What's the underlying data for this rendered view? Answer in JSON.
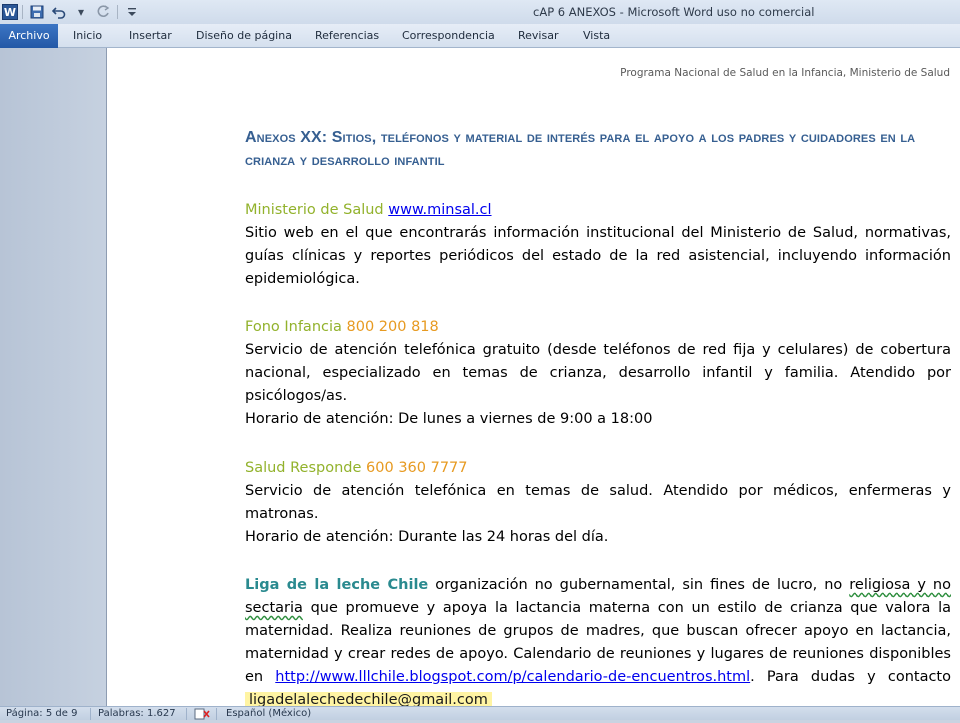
{
  "app": {
    "window_title": "cAP 6 ANEXOS - Microsoft Word uso no comercial",
    "word_logo": "W",
    "quick_access": [
      "save-icon",
      "undo-icon",
      "redo-icon",
      "customize-icon"
    ]
  },
  "ribbon": {
    "tabs": [
      "Archivo",
      "Inicio",
      "Insertar",
      "Diseño de página",
      "Referencias",
      "Correspondencia",
      "Revisar",
      "Vista"
    ]
  },
  "document": {
    "header_note": "Programa Nacional de Salud en la Infancia, Ministerio de Salud",
    "heading": "Anexos XX: Sitios, teléfonos y material de interés para el apoyo a los padres y cuidadores en la crianza y desarrollo infantil",
    "minsal": {
      "name": "Ministerio de Salud",
      "url": "www.minsal.cl",
      "description": "Sitio web en el que encontrarás información institucional del Ministerio de Salud, normativas, guías clínicas y reportes periódicos del estado de la red asistencial, incluyendo información epidemiológica."
    },
    "fono": {
      "name": "Fono Infancia",
      "phone": "800 200 818",
      "description": "Servicio de atención telefónica gratuito (desde teléfonos de red fija y celulares) de cobertura nacional, especializado en temas de crianza, desarrollo infantil y familia. Atendido por psicólogos/as.",
      "horario": "Horario de atención:  De lunes a viernes de 9:00 a 18:00"
    },
    "salud": {
      "name": "Salud Responde",
      "phone": "600 360 7777",
      "description": "Servicio de atención telefónica en temas de salud. Atendido por médicos, enfermeras y matronas.",
      "horario": "Horario de atención:  Durante las 24 horas del día."
    },
    "liga": {
      "name": "Liga de la leche Chile",
      "text_a": " organización no gubernamental, sin fines de lucro, no ",
      "sq1": "religiosa y no sectaria",
      "text_b": " que promueve y apoya la lactancia materna con un estilo de crianza que valora la maternidad.  Realiza reuniones de grupos de madres, que buscan ofrecer apoyo en lactancia, maternidad y crear redes de apoyo. Calendario de reuniones y  lugares de reuniones disponibles en ",
      "link": "http://www.lllchile.blogspot.com/p/calendario-de-encuentros.html",
      "text_c": ". Para dudas y contacto ",
      "email": "ligadelalechedechile@gmail.com"
    }
  },
  "status": {
    "page": "Página: 5 de 9",
    "words": "Palabras: 1.627",
    "proofing_icon": "spellcheck-icon",
    "language": "Español (México)"
  }
}
